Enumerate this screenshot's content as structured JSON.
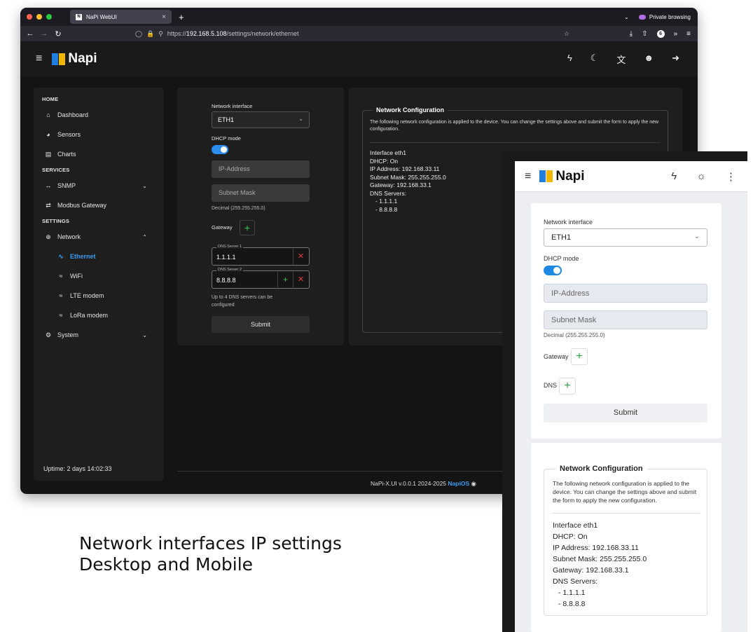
{
  "browser": {
    "tab_title": "NaPi WebUI",
    "tab_close": "×",
    "new_tab": "+",
    "private_label": "Private browsing",
    "url_scheme": "https://",
    "url_host": "192.168.5.108",
    "url_path": "/settings/network/ethernet",
    "dots": [
      "#ff5f57",
      "#febc2e",
      "#28c840"
    ]
  },
  "app": {
    "logo_text": "Napi",
    "logo_colors": {
      "left": "#1f7ee0",
      "right": "#f2b500"
    }
  },
  "sidebar": {
    "sections": [
      {
        "title": "HOME",
        "items": [
          {
            "label": "Dashboard",
            "icon": "home-icon"
          },
          {
            "label": "Sensors",
            "icon": "gauge-icon"
          },
          {
            "label": "Charts",
            "icon": "chart-icon"
          }
        ]
      },
      {
        "title": "SERVICES",
        "items": [
          {
            "label": "SNMP",
            "icon": "arrows-horizontal-icon"
          },
          {
            "label": "Modbus Gateway",
            "icon": "swap-icon"
          }
        ]
      },
      {
        "title": "SETTINGS",
        "items": [
          {
            "label": "Network",
            "icon": "globe-icon"
          },
          {
            "label": "Ethernet",
            "icon": "pulse-icon"
          },
          {
            "label": "WiFi",
            "icon": "wifi-icon"
          },
          {
            "label": "LTE modem",
            "icon": "wifi-icon"
          },
          {
            "label": "LoRa modem",
            "icon": "wifi-icon"
          },
          {
            "label": "System",
            "icon": "gear-icon"
          }
        ]
      }
    ],
    "uptime": "Uptime: 2 days 14:02:33"
  },
  "form": {
    "interface_label": "Network interface",
    "interface_value": "ETH1",
    "dhcp_label": "DHCP mode",
    "dhcp_on": true,
    "ip_placeholder": "IP-Address",
    "mask_placeholder": "Subnet Mask",
    "mask_hint": "Decimal (255.255.255.0)",
    "gateway_label": "Gateway",
    "dns1_legend": "DNS Server 1",
    "dns1_value": "1.1.1.1",
    "dns2_legend": "DNS Server 2",
    "dns2_value": "8.8.8.8",
    "dns_note": "Up to 4 DNS servers can be configured",
    "submit_label": "Submit",
    "dns_label": "DNS"
  },
  "config": {
    "title": "Network Configuration",
    "description": "The following network configuration is applied to the device. You can change the settings above and submit the form to apply the new configuration.",
    "interface": "Interface eth1",
    "dhcp": "DHCP: On",
    "ip": "IP Address: 192.168.33.11",
    "mask": "Subnet Mask: 255.255.255.0",
    "gateway": "Gateway: 192.168.33.1",
    "dns_header": "DNS Servers:",
    "dns1": "- 1.1.1.1",
    "dns2": "- 8.8.8.8"
  },
  "footer": {
    "version": "NaPi-X.UI v.0.0.1 2024-2025",
    "os": "NapiOS"
  },
  "caption": {
    "line1": "Network interfaces IP settings",
    "line2": "Desktop and Mobile"
  },
  "accent_color": "#2d8cf0"
}
